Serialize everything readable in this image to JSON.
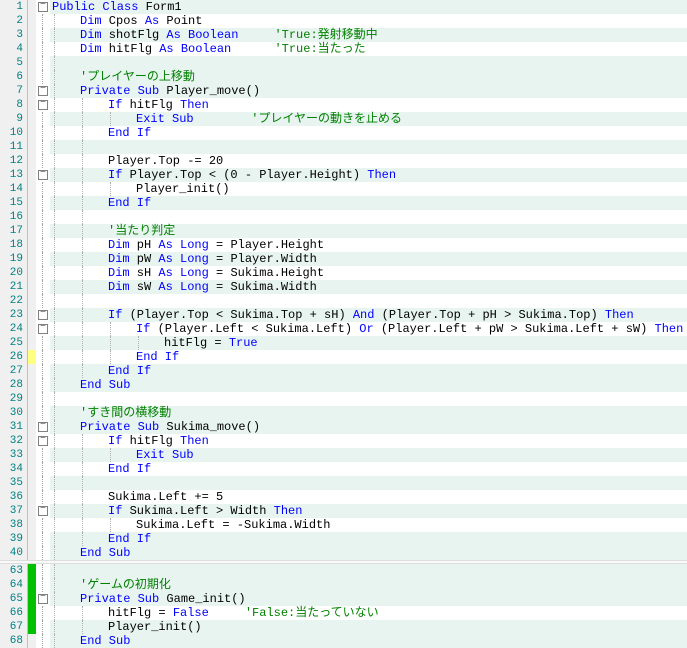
{
  "lines": [
    {
      "n": 1,
      "fold": "mark",
      "bg": "hl0",
      "indent": 0,
      "tokens": [
        [
          "kw",
          "Public Class"
        ],
        [
          "id",
          " Form1"
        ]
      ]
    },
    {
      "n": 2,
      "fold": "line",
      "bg": "hl1",
      "indent": 1,
      "tokens": [
        [
          "kw",
          "Dim"
        ],
        [
          "id",
          " Cpos "
        ],
        [
          "kw",
          "As"
        ],
        [
          "id",
          " Point"
        ]
      ]
    },
    {
      "n": 3,
      "fold": "line",
      "bg": "hl0",
      "indent": 1,
      "tokens": [
        [
          "kw",
          "Dim"
        ],
        [
          "id",
          " shotFlg "
        ],
        [
          "kw",
          "As Boolean"
        ],
        [
          "id",
          "     "
        ],
        [
          "cm",
          "'True:発射移動中"
        ]
      ]
    },
    {
      "n": 4,
      "fold": "line",
      "bg": "hl1",
      "indent": 1,
      "tokens": [
        [
          "kw",
          "Dim"
        ],
        [
          "id",
          " hitFlg "
        ],
        [
          "kw",
          "As Boolean"
        ],
        [
          "id",
          "      "
        ],
        [
          "cm",
          "'True:当たった"
        ]
      ]
    },
    {
      "n": 5,
      "fold": "line",
      "bg": "hl0",
      "indent": 1,
      "tokens": []
    },
    {
      "n": 6,
      "fold": "line",
      "bg": "hl0",
      "indent": 1,
      "tokens": [
        [
          "cm",
          "'プレイヤーの上移動"
        ]
      ]
    },
    {
      "n": 7,
      "fold": "mark",
      "bg": "hl0",
      "indent": 1,
      "tokens": [
        [
          "kw",
          "Private Sub"
        ],
        [
          "id",
          " Player_move()"
        ]
      ]
    },
    {
      "n": 8,
      "fold": "mark",
      "bg": "hl1",
      "indent": 2,
      "tokens": [
        [
          "kw",
          "If"
        ],
        [
          "id",
          " hitFlg "
        ],
        [
          "kw",
          "Then"
        ]
      ]
    },
    {
      "n": 9,
      "fold": "line",
      "bg": "hl0",
      "indent": 3,
      "tokens": [
        [
          "kw",
          "Exit Sub"
        ],
        [
          "id",
          "        "
        ],
        [
          "cm",
          "'プレイヤーの動きを止める"
        ]
      ]
    },
    {
      "n": 10,
      "fold": "line",
      "bg": "hl1",
      "indent": 2,
      "tokens": [
        [
          "kw",
          "End If"
        ]
      ]
    },
    {
      "n": 11,
      "fold": "line",
      "bg": "hl0",
      "indent": 2,
      "tokens": []
    },
    {
      "n": 12,
      "fold": "line",
      "bg": "hl1",
      "indent": 2,
      "tokens": [
        [
          "id",
          "Player.Top -= 20"
        ]
      ]
    },
    {
      "n": 13,
      "fold": "mark",
      "bg": "hl0",
      "indent": 2,
      "tokens": [
        [
          "kw",
          "If"
        ],
        [
          "id",
          " Player.Top < (0 - Player.Height) "
        ],
        [
          "kw",
          "Then"
        ]
      ]
    },
    {
      "n": 14,
      "fold": "line",
      "bg": "hl1",
      "indent": 3,
      "tokens": [
        [
          "id",
          "Player_init()"
        ]
      ]
    },
    {
      "n": 15,
      "fold": "line",
      "bg": "hl0",
      "indent": 2,
      "tokens": [
        [
          "kw",
          "End If"
        ]
      ]
    },
    {
      "n": 16,
      "fold": "line",
      "bg": "hl1",
      "indent": 2,
      "tokens": []
    },
    {
      "n": 17,
      "fold": "line",
      "bg": "hl0",
      "indent": 2,
      "tokens": [
        [
          "cm",
          "'当たり判定"
        ]
      ]
    },
    {
      "n": 18,
      "fold": "line",
      "bg": "hl1",
      "indent": 2,
      "tokens": [
        [
          "kw",
          "Dim"
        ],
        [
          "id",
          " pH "
        ],
        [
          "kw",
          "As Long"
        ],
        [
          "id",
          " = Player.Height"
        ]
      ]
    },
    {
      "n": 19,
      "fold": "line",
      "bg": "hl0",
      "indent": 2,
      "tokens": [
        [
          "kw",
          "Dim"
        ],
        [
          "id",
          " pW "
        ],
        [
          "kw",
          "As Long"
        ],
        [
          "id",
          " = Player.Width"
        ]
      ]
    },
    {
      "n": 20,
      "fold": "line",
      "bg": "hl1",
      "indent": 2,
      "tokens": [
        [
          "kw",
          "Dim"
        ],
        [
          "id",
          " sH "
        ],
        [
          "kw",
          "As Long"
        ],
        [
          "id",
          " = Sukima.Height"
        ]
      ]
    },
    {
      "n": 21,
      "fold": "line",
      "bg": "hl0",
      "indent": 2,
      "tokens": [
        [
          "kw",
          "Dim"
        ],
        [
          "id",
          " sW "
        ],
        [
          "kw",
          "As Long"
        ],
        [
          "id",
          " = Sukima.Width"
        ]
      ]
    },
    {
      "n": 22,
      "fold": "line",
      "bg": "hl1",
      "indent": 2,
      "tokens": []
    },
    {
      "n": 23,
      "fold": "mark",
      "bg": "hl0",
      "indent": 2,
      "tokens": [
        [
          "kw",
          "If"
        ],
        [
          "id",
          " (Player.Top < Sukima.Top + sH) "
        ],
        [
          "kw",
          "And"
        ],
        [
          "id",
          " (Player.Top + pH > Sukima.Top) "
        ],
        [
          "kw",
          "Then"
        ]
      ]
    },
    {
      "n": 24,
      "fold": "mark",
      "bg": "hl1",
      "indent": 3,
      "tokens": [
        [
          "kw",
          "If"
        ],
        [
          "id",
          " (Player.Left < Sukima.Left) "
        ],
        [
          "kw",
          "Or"
        ],
        [
          "id",
          " (Player.Left + pW > Sukima.Left + sW) "
        ],
        [
          "kw",
          "Then"
        ]
      ]
    },
    {
      "n": 25,
      "fold": "line",
      "bg": "hl0",
      "indent": 4,
      "tokens": [
        [
          "id",
          "hitFlg = "
        ],
        [
          "kw",
          "True"
        ]
      ]
    },
    {
      "n": 26,
      "fold": "line",
      "bg": "hl1",
      "indent": 3,
      "marker": "yellow",
      "tokens": [
        [
          "kw",
          "End If"
        ]
      ]
    },
    {
      "n": 27,
      "fold": "line",
      "bg": "hl0",
      "indent": 2,
      "tokens": [
        [
          "kw",
          "End If"
        ]
      ]
    },
    {
      "n": 28,
      "fold": "line",
      "bg": "hl0",
      "indent": 1,
      "tokens": [
        [
          "kw",
          "End Sub"
        ]
      ]
    },
    {
      "n": 29,
      "fold": "line",
      "bg": "hl1",
      "indent": 1,
      "tokens": []
    },
    {
      "n": 30,
      "fold": "line",
      "bg": "hl0",
      "indent": 1,
      "tokens": [
        [
          "cm",
          "'すき間の横移動"
        ]
      ]
    },
    {
      "n": 31,
      "fold": "mark",
      "bg": "hl0",
      "indent": 1,
      "tokens": [
        [
          "kw",
          "Private Sub"
        ],
        [
          "id",
          " Sukima_move()"
        ]
      ]
    },
    {
      "n": 32,
      "fold": "mark",
      "bg": "hl1",
      "indent": 2,
      "tokens": [
        [
          "kw",
          "If"
        ],
        [
          "id",
          " hitFlg "
        ],
        [
          "kw",
          "Then"
        ]
      ]
    },
    {
      "n": 33,
      "fold": "line",
      "bg": "hl0",
      "indent": 3,
      "tokens": [
        [
          "kw",
          "Exit Sub"
        ]
      ]
    },
    {
      "n": 34,
      "fold": "line",
      "bg": "hl1",
      "indent": 2,
      "tokens": [
        [
          "kw",
          "End If"
        ]
      ]
    },
    {
      "n": 35,
      "fold": "line",
      "bg": "hl0",
      "indent": 2,
      "tokens": []
    },
    {
      "n": 36,
      "fold": "line",
      "bg": "hl1",
      "indent": 2,
      "tokens": [
        [
          "id",
          "Sukima.Left += 5"
        ]
      ]
    },
    {
      "n": 37,
      "fold": "mark",
      "bg": "hl0",
      "indent": 2,
      "tokens": [
        [
          "kw",
          "If"
        ],
        [
          "id",
          " Sukima.Left > Width "
        ],
        [
          "kw",
          "Then"
        ]
      ]
    },
    {
      "n": 38,
      "fold": "line",
      "bg": "hl1",
      "indent": 3,
      "tokens": [
        [
          "id",
          "Sukima.Left = -Sukima.Width"
        ]
      ]
    },
    {
      "n": 39,
      "fold": "line",
      "bg": "hl0",
      "indent": 2,
      "tokens": [
        [
          "kw",
          "End If"
        ]
      ]
    },
    {
      "n": 40,
      "fold": "line",
      "bg": "hl0",
      "indent": 1,
      "tokens": [
        [
          "kw",
          "End Sub"
        ]
      ]
    }
  ],
  "lines2": [
    {
      "n": 63,
      "fold": "line",
      "bg": "hl0",
      "indent": 1,
      "marker": "green",
      "tokens": []
    },
    {
      "n": 64,
      "fold": "line",
      "bg": "hl0",
      "indent": 1,
      "marker": "green",
      "tokens": [
        [
          "cm",
          "'ゲームの初期化"
        ]
      ]
    },
    {
      "n": 65,
      "fold": "mark",
      "bg": "hl0",
      "indent": 1,
      "marker": "green",
      "tokens": [
        [
          "kw",
          "Private Sub"
        ],
        [
          "id",
          " Game_init()"
        ]
      ]
    },
    {
      "n": 66,
      "fold": "line",
      "bg": "hl1",
      "indent": 2,
      "marker": "green",
      "tokens": [
        [
          "id",
          "hitFlg = "
        ],
        [
          "kw",
          "False"
        ],
        [
          "id",
          "     "
        ],
        [
          "cm",
          "'False:当たっていない"
        ]
      ]
    },
    {
      "n": 67,
      "fold": "line",
      "bg": "hl0",
      "indent": 2,
      "marker": "green",
      "tokens": [
        [
          "id",
          "Player_init()"
        ]
      ]
    },
    {
      "n": 68,
      "fold": "line",
      "bg": "hl0",
      "indent": 1,
      "tokens": [
        [
          "kw",
          "End Sub"
        ]
      ]
    }
  ],
  "indentWidth": 28
}
